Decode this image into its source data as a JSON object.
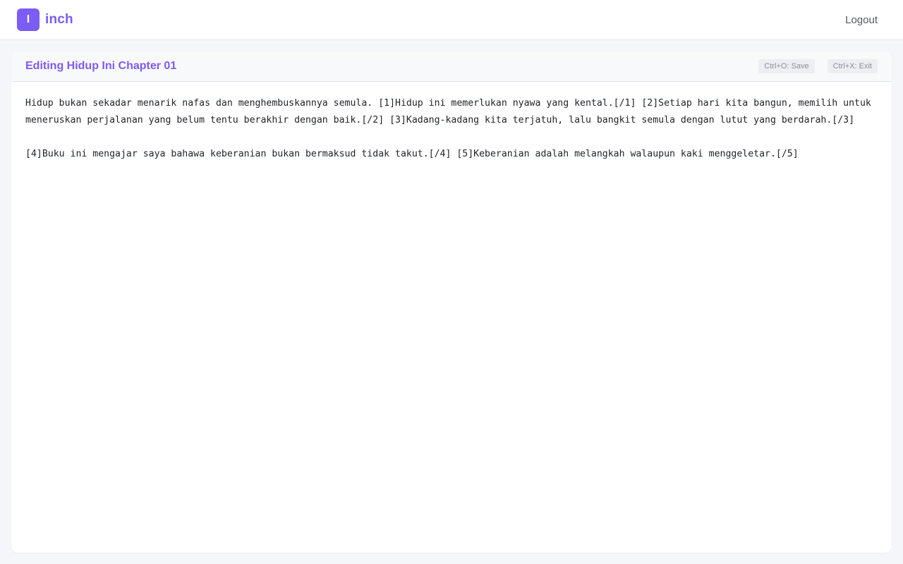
{
  "header": {
    "logo_letter": "I",
    "brand": "inch",
    "logout_label": "Logout",
    "accent_color": "#7b5cf5"
  },
  "editor": {
    "title": "Editing Hidup Ini Chapter 01",
    "save_shortcut": "Ctrl+O: Save",
    "exit_shortcut": "Ctrl+X: Exit",
    "content": "Hidup bukan sekadar menarik nafas dan menghembuskannya semula. [1]Hidup ini memerlukan nyawa yang kental.[/1] [2]Setiap hari kita bangun, memilih untuk meneruskan perjalanan yang belum tentu berakhir dengan baik.[/2] [3]Kadang-kadang kita terjatuh, lalu bangkit semula dengan lutut yang berdarah.[/3]\n\n[4]Buku ini mengajar saya bahawa keberanian bukan bermaksud tidak takut.[/4] [5]Keberanian adalah melangkah walaupun kaki menggeletar.[/5]"
  }
}
